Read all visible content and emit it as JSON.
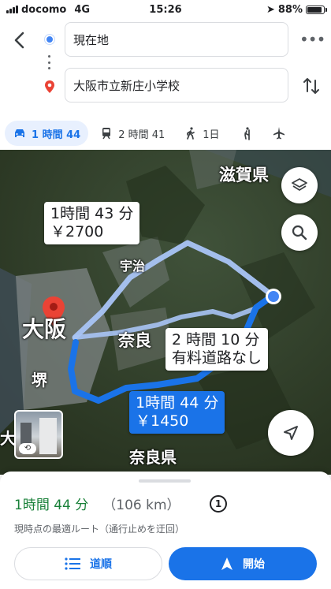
{
  "status": {
    "carrier": "docomo",
    "network": "4G",
    "time": "15:26",
    "battery": "88%",
    "battery_level": 0.88
  },
  "search": {
    "origin": "現在地",
    "destination": "大阪市立新庄小学校"
  },
  "modes": [
    {
      "icon": "car-icon",
      "label": "1 時間 44",
      "active": true
    },
    {
      "icon": "train-icon",
      "label": "2 時間 41"
    },
    {
      "icon": "walk-icon",
      "label": "1日"
    },
    {
      "icon": "ride-icon",
      "label": ""
    },
    {
      "icon": "flight-icon",
      "label": ""
    }
  ],
  "map": {
    "labels": {
      "shiga": "滋賀県",
      "uji": "宇治",
      "osaka": "大阪",
      "nara": "奈良",
      "sakai": "堺",
      "nara_pref": "奈良県",
      "partial": "大"
    },
    "routes": [
      {
        "line1": "1時間 43 分",
        "line2": "￥2700",
        "selected": false
      },
      {
        "line1": "2 時間 10 分",
        "line2": "有料道路なし",
        "selected": false
      },
      {
        "line1": "1時間 44 分",
        "line2": "￥1450",
        "selected": true
      }
    ]
  },
  "sheet": {
    "duration": "1時間 44 分",
    "distance": "（106 km）",
    "info_badge": "1",
    "note": "現時点の最適ルート（通行止めを迂回）",
    "steps_label": "道順",
    "start_label": "開始"
  },
  "colors": {
    "accent": "#1a73e8",
    "duration_green": "#188038",
    "route_alt": "#a9c4f5"
  }
}
